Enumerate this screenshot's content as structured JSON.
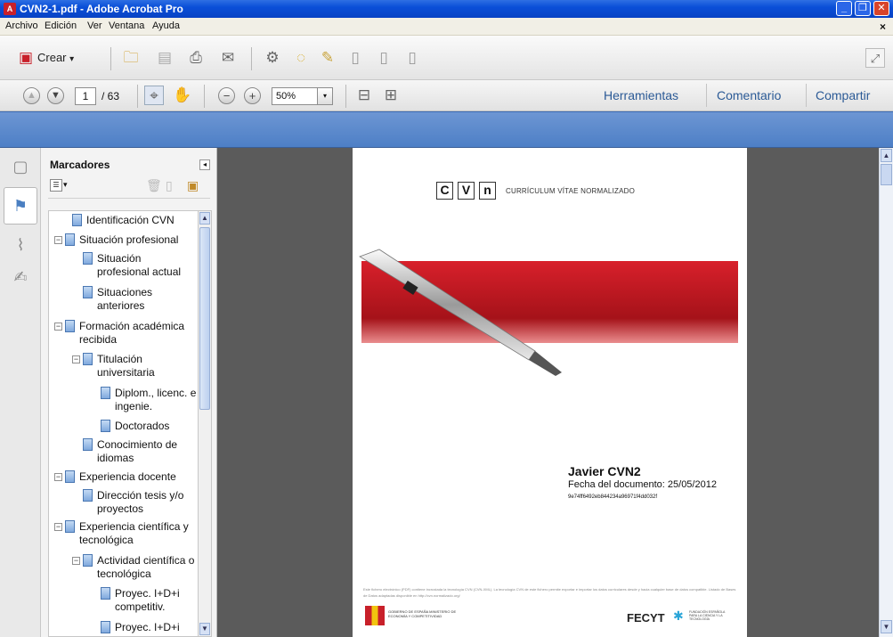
{
  "window": {
    "title": "CVN2-1.pdf - Adobe Acrobat Pro",
    "app_icon": "adobe-pdf-icon",
    "controls": {
      "minimize": "_",
      "maximize": "❐",
      "close": "✕"
    }
  },
  "menubar": {
    "items": [
      "Archivo",
      "Edición",
      "Ver",
      "Ventana",
      "Ayuda"
    ],
    "close_glyph": "×"
  },
  "toolbar": {
    "create_label": "Crear",
    "create_arrow": "▾",
    "icons": [
      "create-pdf-icon",
      "open-folder-icon",
      "save-icon",
      "print-icon",
      "email-icon",
      "settings-icon",
      "comment-icon",
      "sign-icon",
      "secure-icon",
      "export-icon",
      "share-icon"
    ],
    "expand_glyph": "⤢"
  },
  "navbar": {
    "current_page": "1",
    "total_pages": "/ 63",
    "zoom": "50%",
    "zoom_arrow": "▾",
    "tabs": [
      "Herramientas",
      "Comentario",
      "Compartir"
    ]
  },
  "colors": {
    "accent_band": "#5a88cb",
    "doc_bg": "#5b5b5b",
    "link": "#2b5a96",
    "cv_red": "#c8202a"
  },
  "bookmarks": {
    "header": "Marcadores",
    "collapse_glyph": "◂",
    "options_glyph": "▾",
    "items": [
      {
        "label": "Identificación CVN"
      },
      {
        "label": "Situación profesional",
        "expand": "−"
      },
      {
        "label": "Situación profesional actual"
      },
      {
        "label": "Situaciones anteriores"
      },
      {
        "label": "Formación académica recibida",
        "expand": "−"
      },
      {
        "label": "Titulación universitaria",
        "expand": "−"
      },
      {
        "label": "Diplom., licenc. e ingenie."
      },
      {
        "label": "Doctorados"
      },
      {
        "label": "Conocimiento de idiomas"
      },
      {
        "label": "Experiencia docente",
        "expand": "−"
      },
      {
        "label": "Dirección tesis y/o proyectos"
      },
      {
        "label": "Experiencia científica y tecnológica",
        "expand": "−"
      },
      {
        "label": "Actividad científica o tecnológica",
        "expand": "−"
      },
      {
        "label": "Proyec. I+D+i competitiv."
      },
      {
        "label": "Proyec. I+D+i"
      }
    ]
  },
  "document": {
    "logo_letters": [
      "C",
      "V",
      "n"
    ],
    "tagline": "CURRÍCULUM VÍTAE NORMALIZADO",
    "name": "Javier CVN2",
    "date": "Fecha del documento: 25/05/2012",
    "hash": "9e74ff6492eb844234a96971f4dd032f",
    "footer": "Este fichero electrónico (PDF) contiene incrustada la tecnología CVN (CVN-XML). La tecnología CVN de este fichero permite exportar e importar los datos curriculares desde y hacia cualquier base de datos compatible. Listado de Bases de Datos adaptadas disponible en http://cvn.normalizado.org/",
    "gov_label": "GOBIERNO DE ESPAÑA   MINISTERIO DE ECONOMÍA Y COMPETITIVIDAD",
    "fecyt": "FECYT",
    "fecyt_sub": "FUNDACIÓN ESPAÑOLA PARA LA CIENCIA Y LA TECNOLOGÍA"
  },
  "scroll": {
    "up": "▲",
    "down": "▼"
  }
}
